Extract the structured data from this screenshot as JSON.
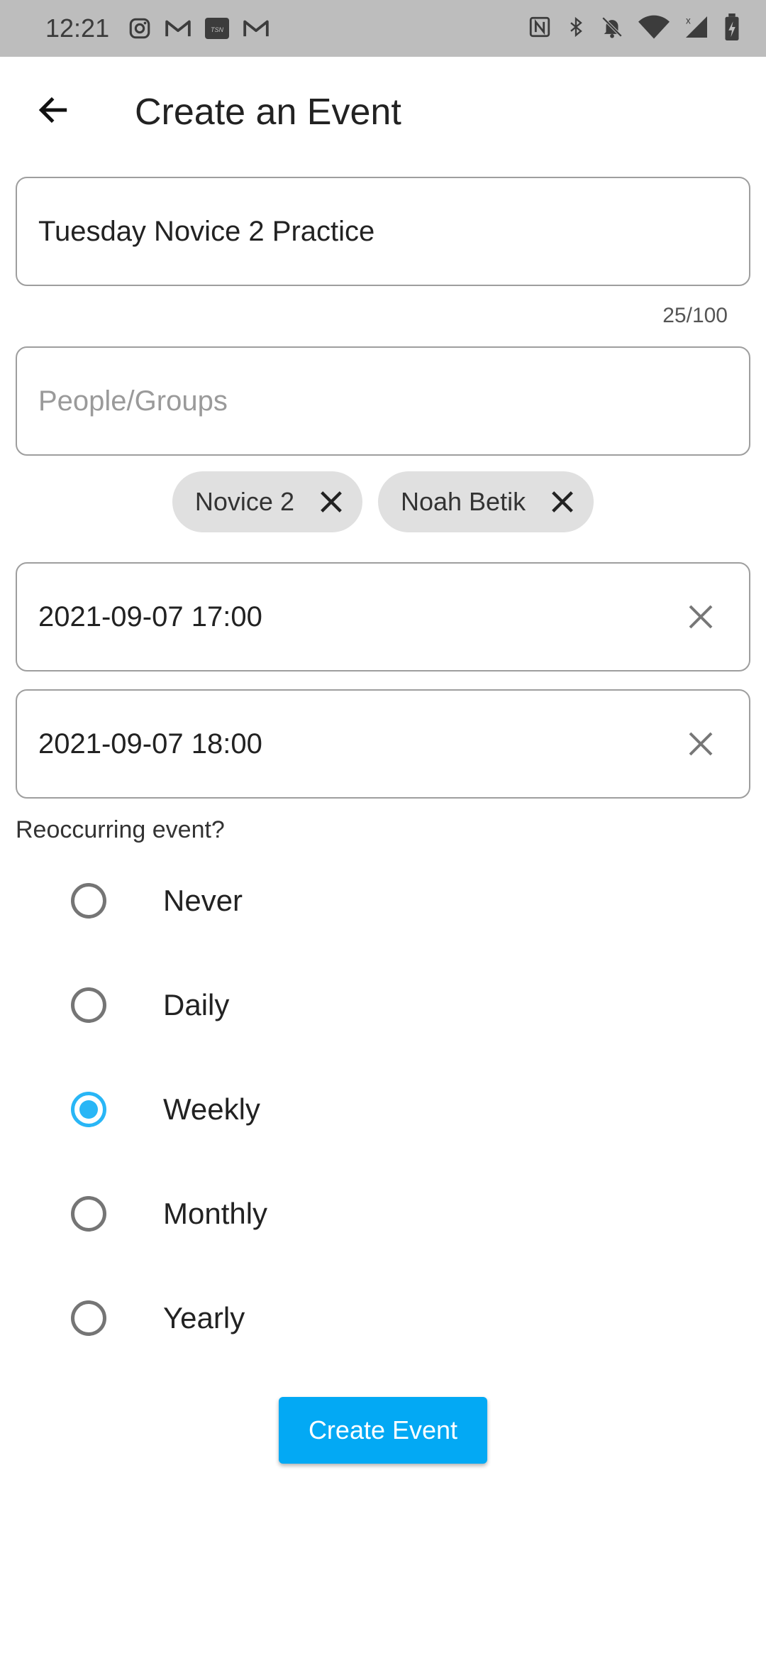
{
  "status_bar": {
    "time": "12:21",
    "left_icons": [
      "instagram-icon",
      "gmail-icon",
      "tsn-icon",
      "gmail-icon"
    ],
    "tsn_text": "TSN",
    "right_icons": [
      "nfc-icon",
      "bluetooth-icon",
      "notifications-off-icon",
      "wifi-icon",
      "signal-icon",
      "battery-icon"
    ]
  },
  "header": {
    "title": "Create an Event",
    "back_icon": "arrow-back-icon"
  },
  "form": {
    "event_name": {
      "value": "Tuesday Novice 2 Practice",
      "counter": "25/100"
    },
    "people_groups": {
      "placeholder": "People/Groups",
      "chips": [
        {
          "label": "Novice 2"
        },
        {
          "label": "Noah Betik"
        }
      ]
    },
    "start_time": {
      "value": "2021-09-07 17:00"
    },
    "end_time": {
      "value": "2021-09-07 18:00"
    },
    "reoccurring": {
      "label": "Reoccurring event?",
      "options": [
        {
          "label": "Never",
          "selected": false
        },
        {
          "label": "Daily",
          "selected": false
        },
        {
          "label": "Weekly",
          "selected": true
        },
        {
          "label": "Monthly",
          "selected": false
        },
        {
          "label": "Yearly",
          "selected": false
        }
      ]
    },
    "submit_label": "Create Event"
  },
  "colors": {
    "accent": "#03a9f4",
    "radio_selected": "#29b6f6",
    "status_bar_bg": "#bdbdbd",
    "chip_bg": "#e0e0e0"
  }
}
